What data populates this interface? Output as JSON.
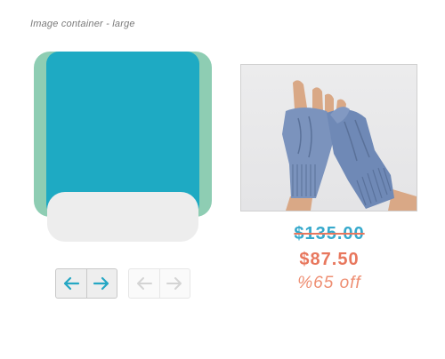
{
  "caption": "Image container - large",
  "navigation": {
    "active": {
      "prev_icon": "arrow-left-icon",
      "next_icon": "arrow-right-icon"
    },
    "disabled": {
      "prev_icon": "arrow-left-icon",
      "next_icon": "arrow-right-icon"
    }
  },
  "product": {
    "image_icon": "knitted-fingerless-gloves-photo",
    "original_price": "$135.00",
    "sale_price": "$87.50",
    "discount": "%65 off"
  },
  "colors": {
    "accent_blue": "#1eaac3",
    "accent_green": "#8ecdb3",
    "sale_orange": "#e8775d",
    "price_blue": "#36a9cc"
  }
}
